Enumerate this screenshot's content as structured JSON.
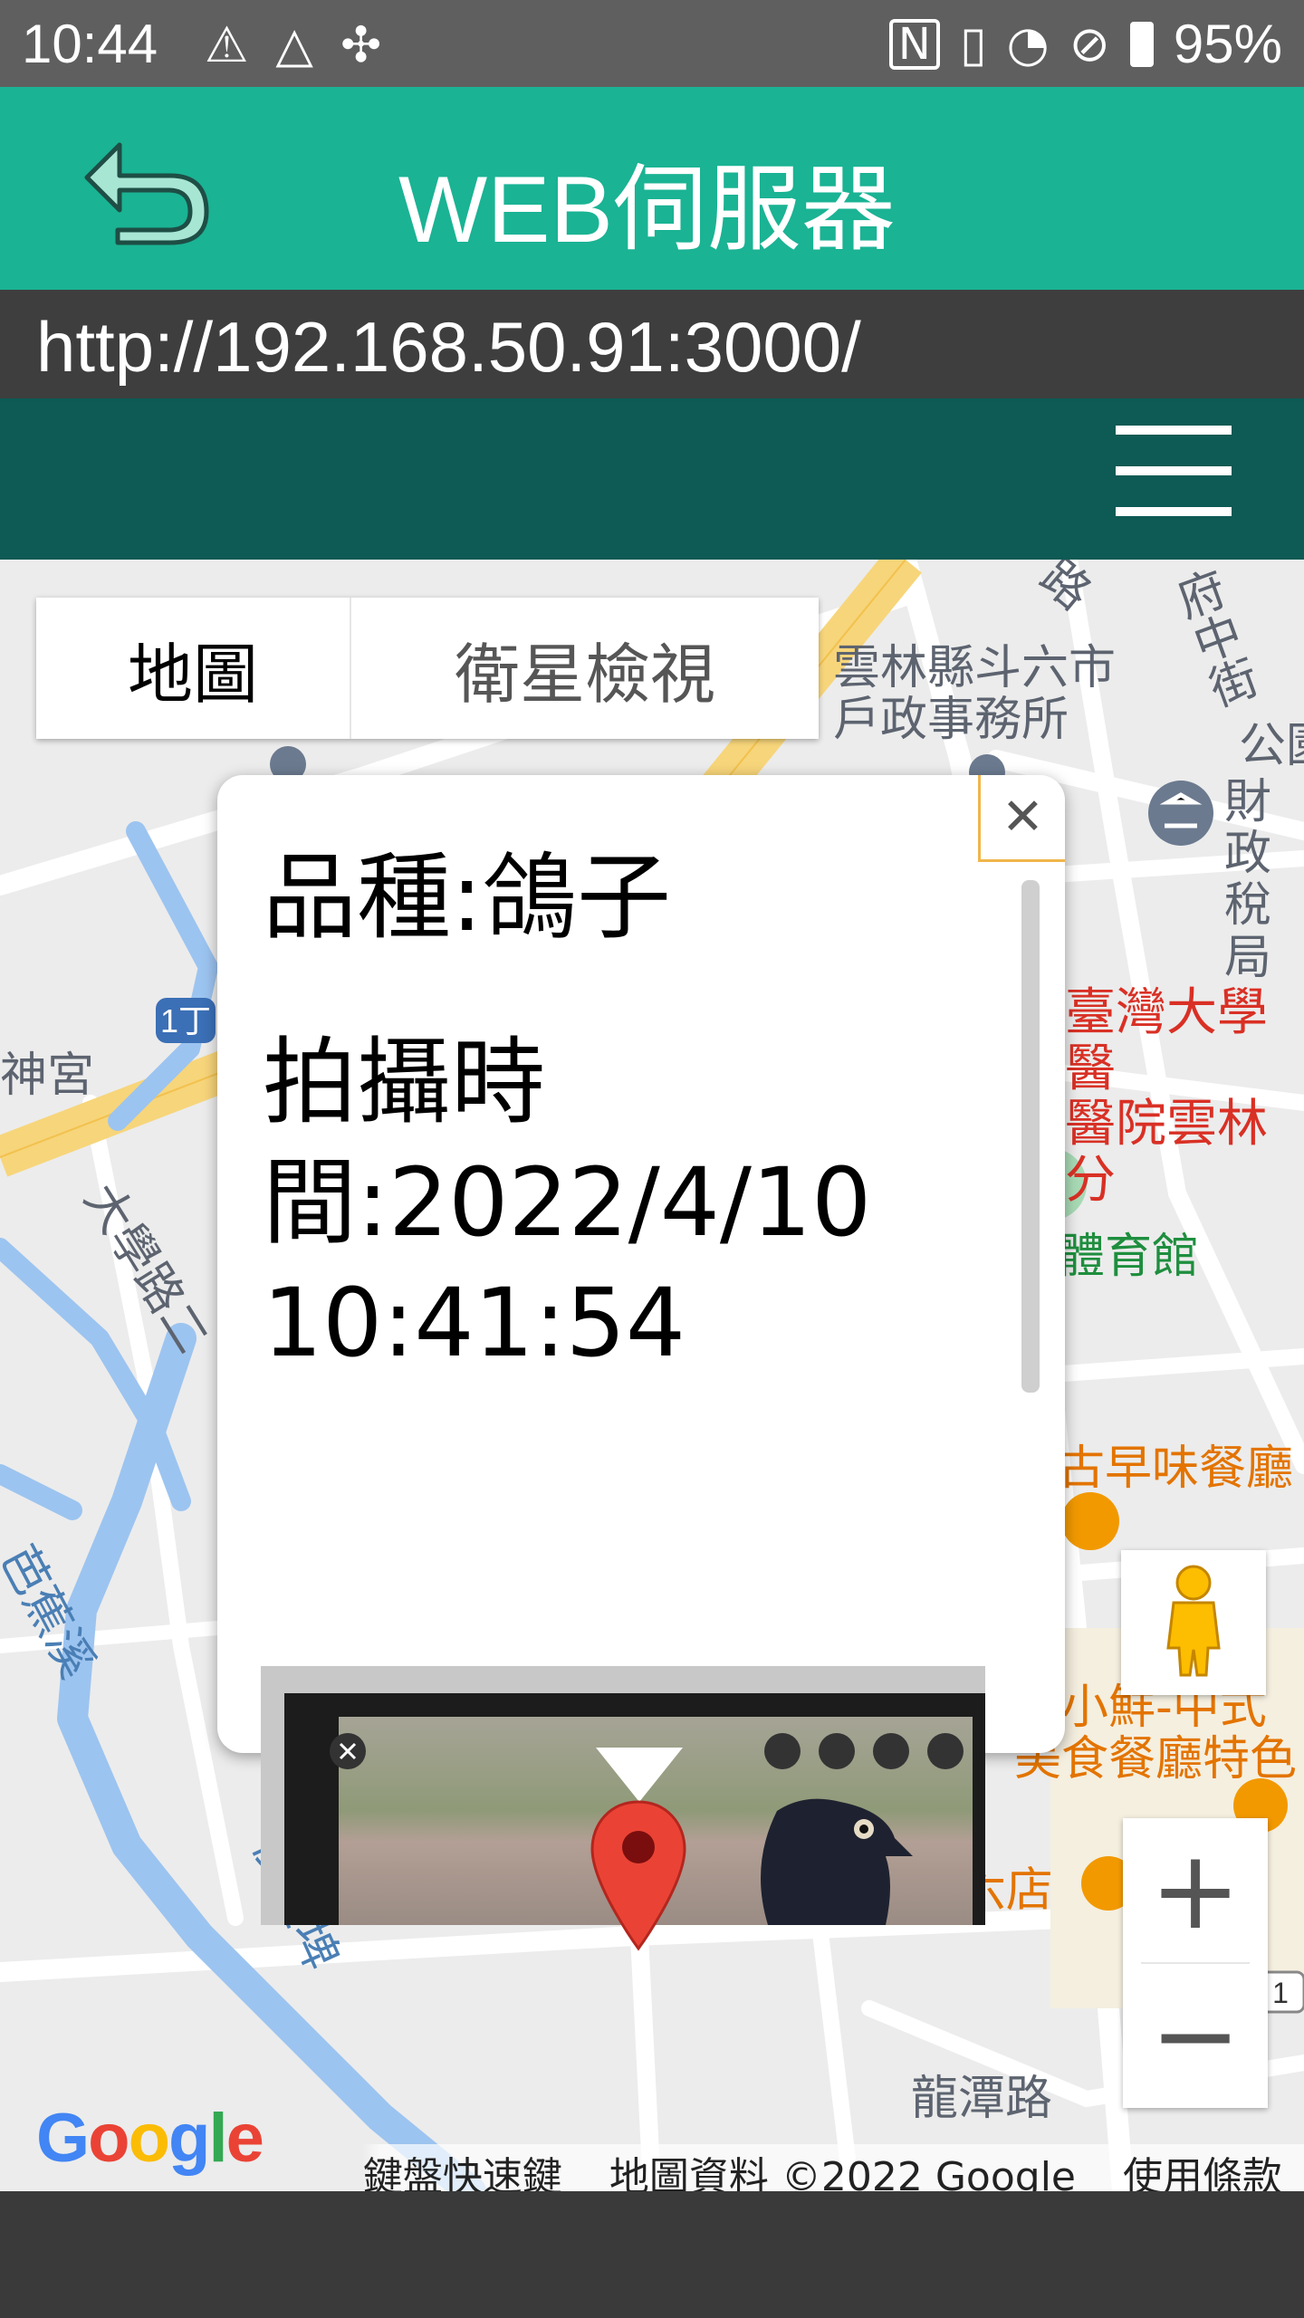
{
  "status_bar": {
    "time": "10:44",
    "battery": "95%",
    "left_icons": [
      "warning-icon",
      "drive-icon",
      "fan-icon"
    ],
    "right_icons": [
      "nfc-icon",
      "vibrate-icon",
      "wifi-icon",
      "no-sim-icon",
      "battery-icon"
    ]
  },
  "app_bar": {
    "title": "WEB伺服器",
    "back_icon": "back-arrow-icon",
    "color": "#1ab394"
  },
  "url_bar": {
    "url": "http://192.168.50.91:3000/"
  },
  "web_nav": {
    "menu_icon": "hamburger-menu-icon",
    "color": "#0e5a54"
  },
  "map": {
    "type_toggle": {
      "map_label": "地圖",
      "satellite_label": "衛星檢視"
    },
    "labels": {
      "household_office": "雲林縣斗六市\n戶政事務所",
      "fuzhong_street": "府中街",
      "lu": "路",
      "park": "公園",
      "tax_office": "財政\n稅局",
      "hospital": "臺灣大學醫\n醫院雲林分",
      "shrine": "神宮",
      "daxue_road": "大學路二",
      "gym": "體育館",
      "breakfast_shop": "古早味餐廳",
      "bajiao_creek": "芭蕉溪",
      "restaurant": "烹小鮮-中式\n美食餐廳特色",
      "houzhuang": "後庄埤",
      "weike": "維克早午餐-斗六店",
      "longtan_road": "龍潭路",
      "route_1d": "1丁",
      "route_1": "1"
    },
    "info_window": {
      "breed": "品種:鴿子",
      "time": "拍攝時\n間:2022/4/10\n10:41:54",
      "close_icon": "close-icon"
    },
    "controls": {
      "pegman_icon": "pegman-icon",
      "zoom_in": "+",
      "zoom_out": "−"
    },
    "google_logo": "Google",
    "attribution": {
      "shortcuts": "鍵盤快速鍵",
      "data": "地圖資料 ©2022 Google",
      "terms": "使用條款"
    }
  }
}
